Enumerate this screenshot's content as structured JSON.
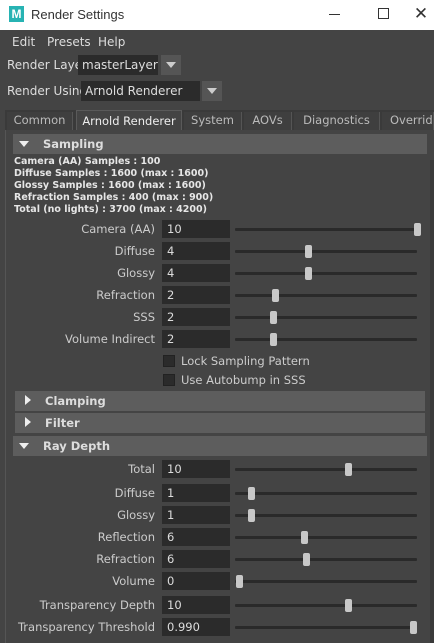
{
  "window": {
    "app_icon": "M",
    "title": "Render Settings"
  },
  "menu": [
    "Edit",
    "Presets",
    "Help"
  ],
  "render_layer": {
    "label": "Render Layer",
    "value": "masterLayer"
  },
  "render_using": {
    "label": "Render Using",
    "value": "Arnold Renderer"
  },
  "tabs": [
    "Common",
    "Arnold Renderer",
    "System",
    "AOVs",
    "Diagnostics",
    "Override"
  ],
  "active_tab": "Arnold Renderer",
  "sampling": {
    "title": "Sampling",
    "info": [
      "Camera (AA) Samples : 100",
      "Diffuse Samples : 1600 (max : 1600)",
      "Glossy Samples : 1600 (max : 1600)",
      "Refraction Samples : 400 (max : 900)",
      "Total (no lights) : 3700 (max : 4200)"
    ],
    "rows": [
      {
        "label": "Camera (AA)",
        "value": "10",
        "slider": 1.0
      },
      {
        "label": "Diffuse",
        "value": "4",
        "slider": 0.4
      },
      {
        "label": "Glossy",
        "value": "4",
        "slider": 0.4
      },
      {
        "label": "Refraction",
        "value": "2",
        "slider": 0.22
      },
      {
        "label": "SSS",
        "value": "2",
        "slider": 0.21
      },
      {
        "label": "Volume Indirect",
        "value": "2",
        "slider": 0.21
      }
    ],
    "checks": [
      {
        "label": "Lock Sampling Pattern",
        "checked": false
      },
      {
        "label": "Use Autobump in SSS",
        "checked": false
      }
    ]
  },
  "clamping": {
    "title": "Clamping"
  },
  "filter": {
    "title": "Filter"
  },
  "ray_depth": {
    "title": "Ray Depth",
    "rows": [
      {
        "label": "Total",
        "value": "10",
        "slider": 0.62
      },
      {
        "label": "Diffuse",
        "value": "1",
        "slider": 0.09
      },
      {
        "label": "Glossy",
        "value": "1",
        "slider": 0.09
      },
      {
        "label": "Reflection",
        "value": "6",
        "slider": 0.38
      },
      {
        "label": "Refraction",
        "value": "6",
        "slider": 0.39
      },
      {
        "label": "Volume",
        "value": "0",
        "slider": 0.02
      },
      {
        "label": "Transparency Depth",
        "value": "10",
        "slider": 0.62
      },
      {
        "label": "Transparency Threshold",
        "value": "0.990",
        "slider": 0.98
      }
    ]
  }
}
